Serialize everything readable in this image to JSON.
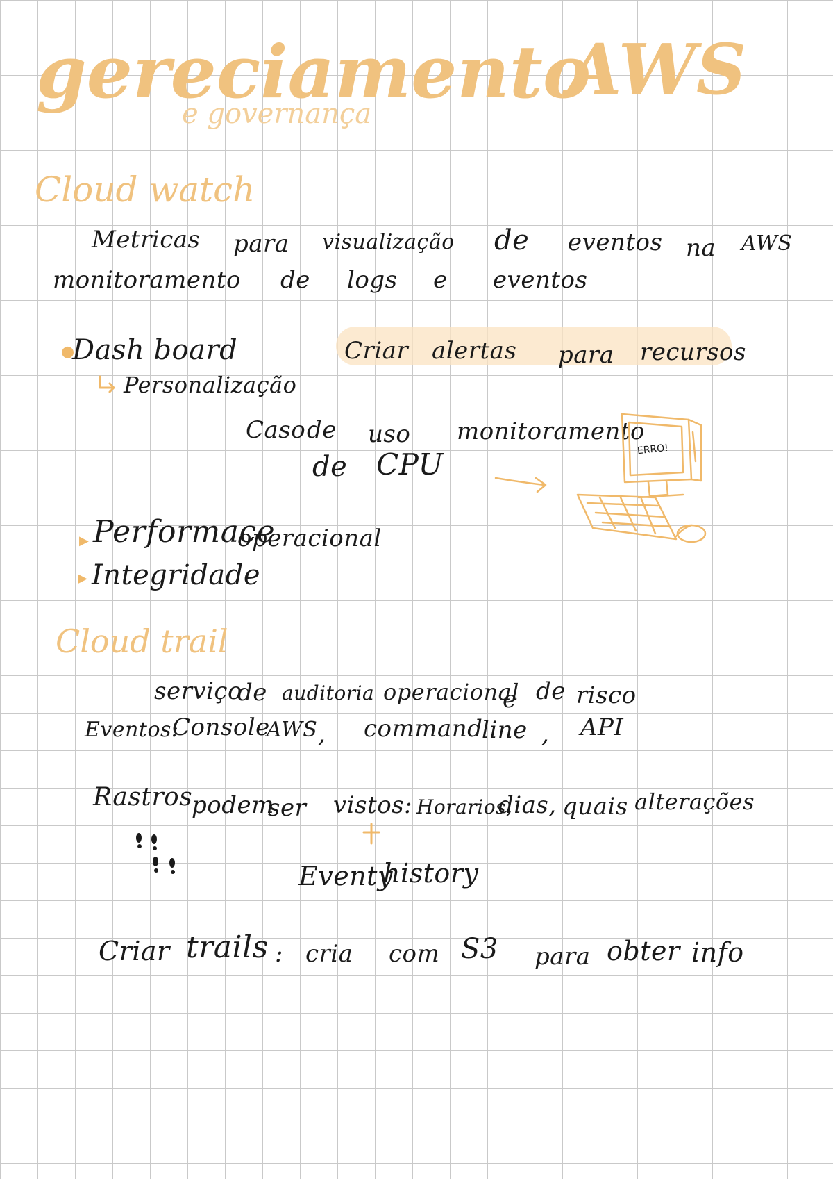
{
  "colors": {
    "accent": "#f0c27f",
    "ink": "#1a1a1a",
    "highlight": "#fbe3c2",
    "grid": "#c9c9c9"
  },
  "title": {
    "main": "gereciamento",
    "aws": "AWS",
    "sub": "e governança"
  },
  "cloudwatch": {
    "heading": "Cloud watch",
    "line1": {
      "w1": "Metricas",
      "w2": "para",
      "w3": "visualização",
      "w4": "de",
      "w5": "eventos",
      "w6": "na",
      "w7": "AWS"
    },
    "line2": {
      "w1": "monitoramento",
      "w2": "de",
      "w3": "logs",
      "w4": "e",
      "w5": "eventos"
    },
    "dashboard": "Dash board",
    "alert": {
      "w1": "Criar",
      "w2": "alertas",
      "w3": "para",
      "w4": "recursos"
    },
    "personalizacao": "Personalização",
    "usecase": {
      "w1": "Caso",
      "w2": "de",
      "w3": "uso",
      "w4": "monitoramento",
      "w5": "de",
      "w6": "CPU"
    },
    "computer_text": "ERRO!",
    "performance": {
      "w1": "Performace",
      "w2": "operacional"
    },
    "integridade": "Integridade"
  },
  "cloudtrail": {
    "heading": "Cloud trail",
    "line1": {
      "w1": "serviço",
      "w2": "de",
      "w3": "auditoria",
      "w4": "operacional",
      "w5": "e",
      "w6": "de",
      "w7": "risco"
    },
    "line2": {
      "w1": "Eventos:",
      "w2": "Console",
      "w3": "AWS",
      "sep1": ",",
      "w4": "command",
      "w5": "line",
      "sep2": ",",
      "w6": "API"
    },
    "line3": {
      "w1": "Rastros",
      "w2": "podem",
      "w3": "ser",
      "w4": "vistos:",
      "w5": "Horarios,",
      "w6": "dias,",
      "w7": "quais",
      "w8": "alterações"
    },
    "event_history": {
      "w1": "Eventy",
      "w2": "history"
    },
    "trails": {
      "w1": "Criar",
      "w2": "trails",
      "sep": ":",
      "w3": "cria",
      "w4": "com",
      "w5": "S3",
      "w6": "para",
      "w7": "obter",
      "w8": "info"
    }
  }
}
